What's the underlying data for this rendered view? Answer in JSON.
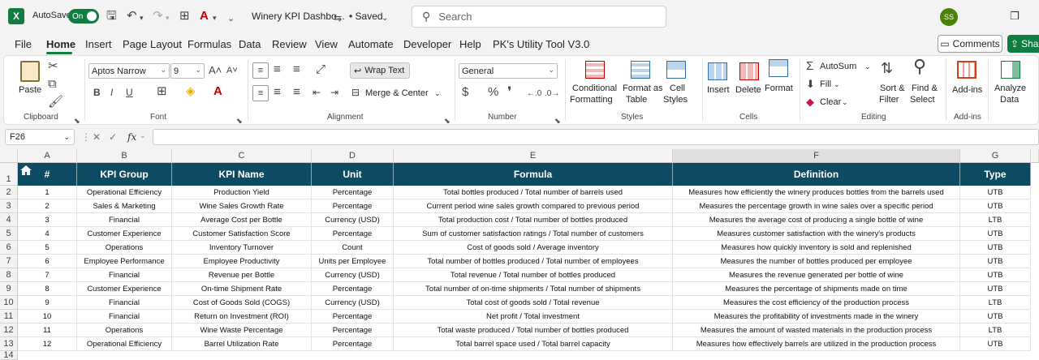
{
  "titlebar": {
    "app_logo": "X",
    "autosave_label": "AutoSave",
    "autosave_state": "On",
    "doc_title": "Winery KPI Dashbo...",
    "saved_status": "• Saved",
    "search_placeholder": "Search",
    "user_initials": "SS"
  },
  "menu": {
    "tabs": [
      "File",
      "Home",
      "Insert",
      "Page Layout",
      "Formulas",
      "Data",
      "Review",
      "View",
      "Automate",
      "Developer",
      "Help",
      "PK's Utility Tool V3.0"
    ],
    "active_tab": "Home",
    "comments_label": "Comments",
    "share_label": "Shar"
  },
  "ribbon": {
    "groups": [
      "Clipboard",
      "Font",
      "Alignment",
      "Number",
      "Styles",
      "Cells",
      "Editing",
      "Add-ins"
    ],
    "paste_label": "Paste",
    "font_name": "Aptos Narrow",
    "font_size": "9",
    "wrap_text_label": "Wrap Text",
    "merge_center_label": "Merge & Center",
    "number_format": "General",
    "conditional_formatting": [
      "Conditional",
      "Formatting"
    ],
    "format_as_table": [
      "Format as",
      "Table"
    ],
    "cell_styles": [
      "Cell",
      "Styles"
    ],
    "insert_label": "Insert",
    "delete_label": "Delete",
    "format_label": "Format",
    "autosum_label": "AutoSum",
    "fill_label": "Fill",
    "clear_label": "Clear",
    "sort_filter": [
      "Sort &",
      "Filter"
    ],
    "find_select": [
      "Find &",
      "Select"
    ],
    "addins_label": "Add-ins",
    "analyze_data": [
      "Analyze",
      "Data"
    ]
  },
  "formula_bar": {
    "name_box": "F26",
    "fx_label": "fx",
    "formula": ""
  },
  "sheet": {
    "column_letters": [
      "A",
      "B",
      "C",
      "D",
      "E",
      "F",
      "G"
    ],
    "row_numbers": [
      "1",
      "2",
      "3",
      "4",
      "5",
      "6",
      "7",
      "8",
      "9",
      "10",
      "11",
      "12",
      "13",
      "14"
    ],
    "headers": [
      "#",
      "KPI Group",
      "KPI Name",
      "Unit",
      "Formula",
      "Definition",
      "Type"
    ],
    "rows": [
      [
        "1",
        "Operational Efficiency",
        "Production Yield",
        "Percentage",
        "Total bottles produced / Total number of barrels used",
        "Measures how efficiently the winery produces bottles from the barrels used",
        "UTB"
      ],
      [
        "2",
        "Sales & Marketing",
        "Wine Sales Growth Rate",
        "Percentage",
        "Current period wine sales growth compared to previous period",
        "Measures the percentage growth in wine sales over a specific period",
        "UTB"
      ],
      [
        "3",
        "Financial",
        "Average Cost per Bottle",
        "Currency (USD)",
        "Total production cost / Total number of bottles produced",
        "Measures the average cost of producing a single bottle of wine",
        "LTB"
      ],
      [
        "4",
        "Customer Experience",
        "Customer Satisfaction Score",
        "Percentage",
        "Sum of customer satisfaction ratings / Total number of customers",
        "Measures customer satisfaction with the winery's products",
        "UTB"
      ],
      [
        "5",
        "Operations",
        "Inventory Turnover",
        "Count",
        "Cost of goods sold / Average inventory",
        "Measures how quickly inventory is sold and replenished",
        "UTB"
      ],
      [
        "6",
        "Employee Performance",
        "Employee Productivity",
        "Units per Employee",
        "Total number of bottles produced / Total number of employees",
        "Measures the number of bottles produced per employee",
        "UTB"
      ],
      [
        "7",
        "Financial",
        "Revenue per Bottle",
        "Currency (USD)",
        "Total revenue / Total number of bottles produced",
        "Measures the revenue generated per bottle of wine",
        "UTB"
      ],
      [
        "8",
        "Customer Experience",
        "On-time Shipment Rate",
        "Percentage",
        "Total number of on-time shipments / Total number of shipments",
        "Measures the percentage of shipments made on time",
        "UTB"
      ],
      [
        "9",
        "Financial",
        "Cost of Goods Sold (COGS)",
        "Currency (USD)",
        "Total cost of goods sold / Total revenue",
        "Measures the cost efficiency of the production process",
        "LTB"
      ],
      [
        "10",
        "Financial",
        "Return on Investment (ROI)",
        "Percentage",
        "Net profit / Total investment",
        "Measures the profitability of investments made in the winery",
        "UTB"
      ],
      [
        "11",
        "Operations",
        "Wine Waste Percentage",
        "Percentage",
        "Total waste produced / Total number of bottles produced",
        "Measures the amount of wasted materials in the production process",
        "LTB"
      ],
      [
        "12",
        "Operational Efficiency",
        "Barrel Utilization Rate",
        "Percentage",
        "Total barrel space used / Total barrel capacity",
        "Measures how effectively barrels are utilized in the production process",
        "UTB"
      ]
    ]
  },
  "colors": {
    "header_fill": "#0e4a62",
    "accent": "#107c41"
  }
}
